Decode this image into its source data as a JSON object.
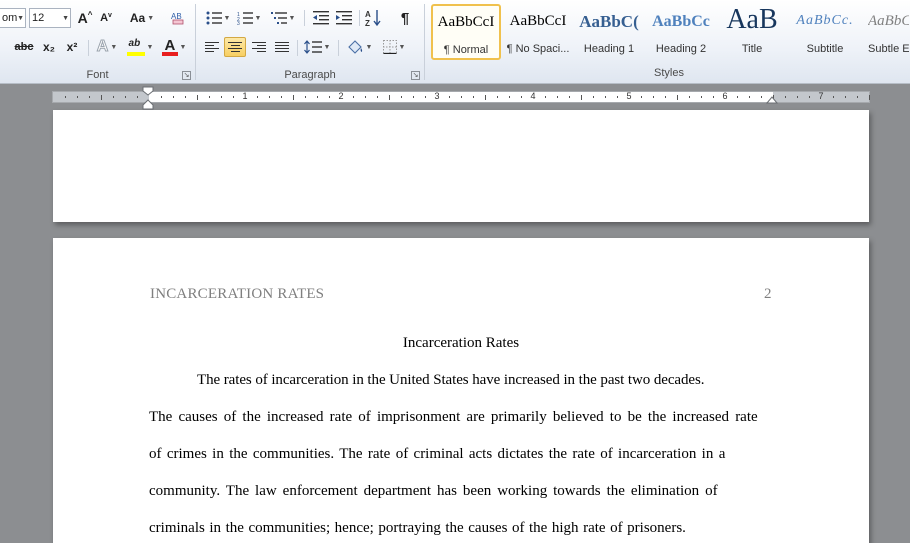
{
  "ribbon": {
    "font": {
      "font_name_partial": "om",
      "font_size": "12",
      "grow_label": "A",
      "shrink_label": "A",
      "change_case_label": "Aa",
      "strike_label": "abc",
      "subscript_label": "x₂",
      "superscript_label": "x²",
      "text_effects_label": "A",
      "highlight_label": "ab",
      "font_color_label": "A",
      "group_label": "Font",
      "highlight_color": "#ffff00",
      "font_color": "#e81e1e"
    },
    "paragraph": {
      "group_label": "Paragraph",
      "sort_label": "A↓Z",
      "pilcrow_label": "¶"
    },
    "styles": {
      "group_label": "Styles",
      "items": [
        {
          "sample": "AaBbCcI",
          "name": "¶ Normal",
          "selected": true
        },
        {
          "sample": "AaBbCcI",
          "name": "¶ No Spaci..."
        },
        {
          "sample": "AaBbC(",
          "name": "Heading 1"
        },
        {
          "sample": "AaBbCc",
          "name": "Heading 2"
        },
        {
          "sample": "AaB",
          "name": "Title"
        },
        {
          "sample": "AaBbCc.",
          "name": "Subtitle"
        },
        {
          "sample": "AaBbCc",
          "name": "Subtle E"
        }
      ]
    }
  },
  "ruler": {
    "numbers": [
      "1",
      "2",
      "3",
      "4",
      "5",
      "6",
      "7"
    ]
  },
  "document": {
    "header_title": "INCARCERATION RATES",
    "page_number": "2",
    "title": "Incarceration Rates",
    "lines": [
      "The rates of incarceration in the United States have increased in the past two decades.",
      "The causes of the increased rate of imprisonment are primarily believed to be the increased rate",
      "of crimes in the communities. The rate of criminal acts dictates the rate of incarceration in a",
      "community. The law enforcement department has been working towards the elimination of",
      "criminals in the communities; hence; portraying the causes of the high rate of prisoners."
    ]
  }
}
